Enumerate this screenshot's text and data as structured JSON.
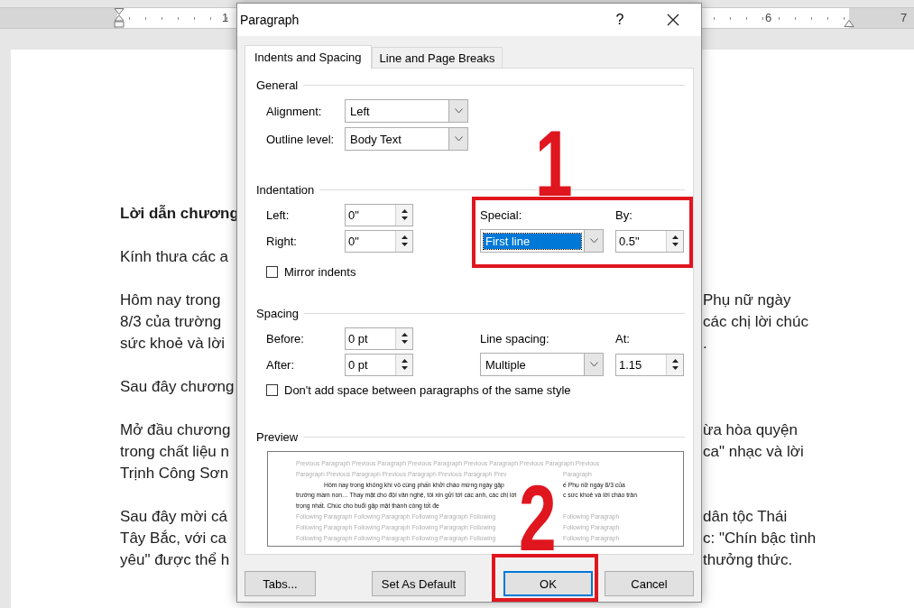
{
  "ruler": {
    "numbers": [
      "1",
      "6",
      "7"
    ]
  },
  "document": {
    "paragraphs": [
      {
        "bold": true,
        "lines": [
          {
            "left": "Lời dẫn chương"
          }
        ]
      },
      {
        "bold": false,
        "lines": [
          {
            "left": "Kính thưa các a"
          }
        ]
      },
      {
        "bold": false,
        "lines": [
          {
            "left": "Hôm nay trong",
            "right": "Phụ nữ ngày"
          },
          {
            "left": "8/3 của trường",
            "right": "các chị lời chúc"
          },
          {
            "left": "sức khoẻ và lời",
            "right": "."
          }
        ]
      },
      {
        "bold": false,
        "lines": [
          {
            "left": "Sau đây chương"
          }
        ]
      },
      {
        "bold": false,
        "lines": [
          {
            "left": "Mở đầu chương",
            "right": "ừa hòa quyện"
          },
          {
            "left": "trong chất liệu n",
            "right": "ca\" nhạc và lời"
          },
          {
            "left": "Trịnh Công Sơn"
          }
        ]
      },
      {
        "bold": false,
        "lines": [
          {
            "left": "Sau đây mời cá",
            "right": "dân tộc Thái"
          },
          {
            "left": "Tây Bắc, với ca",
            "right": "c: \"Chín bậc tình"
          },
          {
            "left": "yêu\" được thể h",
            "right": "thưởng thức."
          }
        ]
      }
    ]
  },
  "dialog": {
    "title": "Paragraph",
    "help": "?",
    "tabs": [
      {
        "label": "Indents and Spacing",
        "selected": true
      },
      {
        "label": "Line and Page Breaks",
        "selected": false
      }
    ],
    "general": {
      "title": "General",
      "fields": [
        {
          "label": "Alignment:",
          "value": "Left",
          "focused": false
        },
        {
          "label": "Outline level:",
          "value": "Body Text",
          "focused": false
        }
      ]
    },
    "indentation": {
      "title": "Indentation",
      "left": {
        "label": "Left:",
        "value": "0\""
      },
      "right": {
        "label": "Right:",
        "value": "0\""
      },
      "special": {
        "label": "Special:",
        "value": "First line",
        "focused": true
      },
      "by": {
        "label": "By:",
        "value": "0.5\""
      },
      "mirror": {
        "label": "Mirror indents",
        "checked": false
      }
    },
    "spacing": {
      "title": "Spacing",
      "before": {
        "label": "Before:",
        "value": "0 pt"
      },
      "after": {
        "label": "After:",
        "value": "0 pt"
      },
      "line_spacing": {
        "label": "Line spacing:",
        "value": "Multiple",
        "focused": false
      },
      "at": {
        "label": "At:",
        "value": "1.15"
      },
      "no_space": {
        "label": "Don't add space between paragraphs of the same style",
        "checked": false
      }
    },
    "preview": {
      "title": "Preview",
      "lines": [
        {
          "kind": "previous",
          "segments": [
            "Previous Paragraph Previous Paragraph Previous Paragraph Previous Paragraph Previous Paragraph Previous"
          ]
        },
        {
          "kind": "previous",
          "segments": [
            "Paragraph Previous Paragraph Previous Paragraph Previous Paragraph Prev",
            "Paragraph"
          ]
        },
        {
          "kind": "first",
          "segments": [
            "Hôm nay trong không khí vô cùng phấn khởi chào mừng ngày gặp",
            "ế Phụ nữ ngày 8/3 của"
          ]
        },
        {
          "kind": "current",
          "segments": [
            "trường mầm non… Thay mặt cho đội văn nghệ, tôi xin gửi tới các anh, các chị lời",
            "c sức khoẻ và lời chào trân"
          ]
        },
        {
          "kind": "current",
          "segments": [
            "trọng nhất. Chúc cho buổi gặp mặt thành công tốt đẹ"
          ]
        },
        {
          "kind": "following",
          "segments": [
            "Following Paragraph Following Paragraph Following Paragraph Following",
            "Following Paragraph"
          ]
        },
        {
          "kind": "following",
          "segments": [
            "Following Paragraph Following Paragraph Following Paragraph Following",
            "Following Paragraph"
          ]
        },
        {
          "kind": "following",
          "segments": [
            "Following Paragraph Following Paragraph Following Paragraph Following",
            "Following Paragraph"
          ]
        }
      ]
    },
    "buttons": [
      {
        "label": "Tabs...",
        "default": false
      },
      {
        "label": "Set As Default",
        "default": false
      },
      {
        "label": "OK",
        "default": true
      },
      {
        "label": "Cancel",
        "default": false
      }
    ]
  },
  "annotations": [
    {
      "label": "1"
    },
    {
      "label": "2"
    }
  ]
}
